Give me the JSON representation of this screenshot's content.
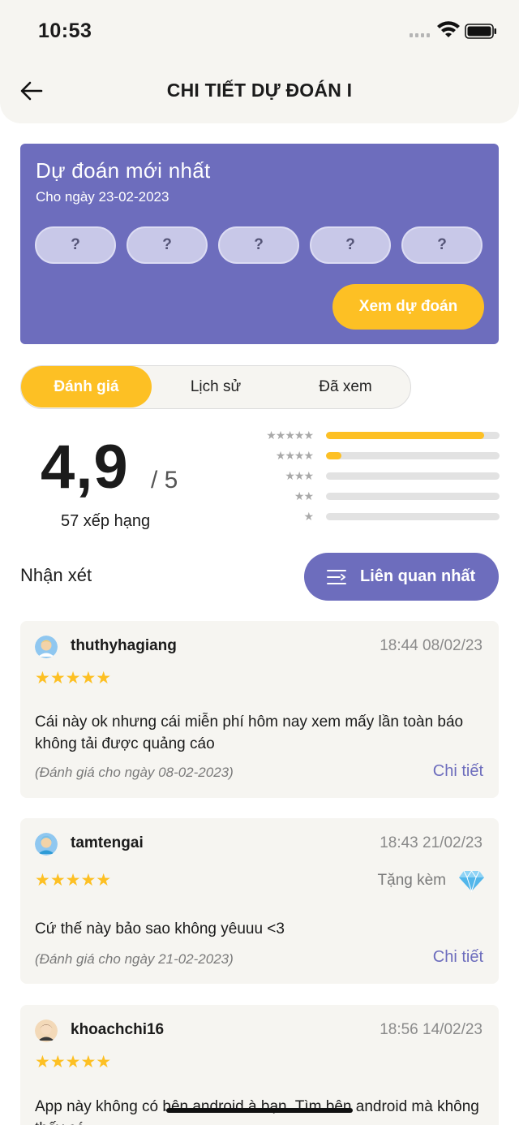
{
  "status": {
    "time": "10:53"
  },
  "header": {
    "title": "CHI TIẾT DỰ ĐOÁN I",
    "back_icon": "arrow-left-icon"
  },
  "prediction": {
    "title": "Dự đoán mới nhất",
    "subtitle": "Cho ngày 23-02-2023",
    "slots": [
      "?",
      "?",
      "?",
      "?",
      "?"
    ],
    "button_label": "Xem dự đoán"
  },
  "tabs": [
    {
      "label": "Đánh giá",
      "active": true
    },
    {
      "label": "Lịch sử",
      "active": false
    },
    {
      "label": "Đã xem",
      "active": false
    }
  ],
  "rating": {
    "score": "4,9",
    "max": "/ 5",
    "count_label": "57 xếp hạng",
    "distribution": [
      {
        "stars": "★★★★★",
        "fraction": 0.91
      },
      {
        "stars": "★★★★",
        "fraction": 0.09
      },
      {
        "stars": "★★★",
        "fraction": 0.0
      },
      {
        "stars": "★★",
        "fraction": 0.0
      },
      {
        "stars": "★",
        "fraction": 0.0
      }
    ]
  },
  "reviews_section": {
    "title": "Nhận xét",
    "sort_label": "Liên quan nhất",
    "sort_icon": "sort-lines-icon"
  },
  "reviews": [
    {
      "user": "thuthyhagiang",
      "time": "18:44 08/02/23",
      "stars": "★★★★★",
      "text": "Cái này ok nhưng cái miễn phí hôm nay xem mấy lần toàn báo không tải được quảng cáo",
      "for_date": "(Đánh giá cho ngày 08-02-2023)",
      "detail_label": "Chi tiết"
    },
    {
      "user": "tamtengai",
      "time": "18:43 21/02/23",
      "stars": "★★★★★",
      "gift_label": "Tặng kèm",
      "text": "Cứ thế này bảo sao không yêuuu <3",
      "for_date": "(Đánh giá cho ngày 21-02-2023)",
      "detail_label": "Chi tiết"
    },
    {
      "user": "khoachchi16",
      "time": "18:56 14/02/23",
      "stars": "★★★★★",
      "text": "App này không có bên android à bạn. Tìm bên android mà không thấy có"
    }
  ],
  "colors": {
    "accent": "#6d6dbd",
    "highlight": "#fdc024",
    "surface": "#f6f5f1"
  }
}
